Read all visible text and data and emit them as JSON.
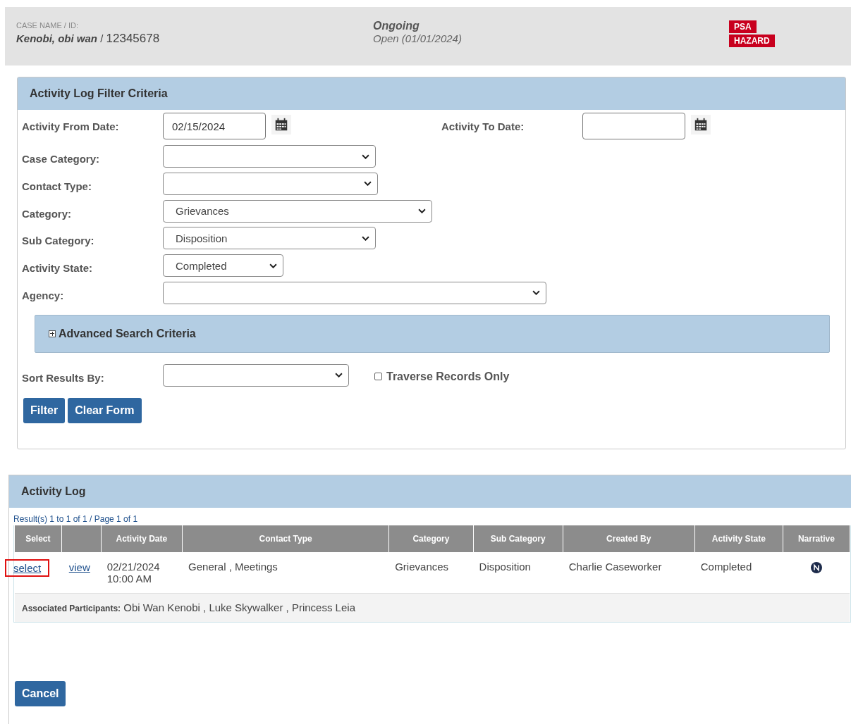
{
  "case_header": {
    "label": "CASE NAME / ID:",
    "name": "Kenobi, obi wan",
    "separator": "/",
    "id": "12345678",
    "status": "Ongoing",
    "open": "Open (01/01/2024)",
    "badges": [
      "PSA",
      "HAZARD"
    ]
  },
  "filter_panel": {
    "title": "Activity Log Filter Criteria",
    "from_date": {
      "label": "Activity From Date:",
      "value": "02/15/2024"
    },
    "to_date": {
      "label": "Activity To Date:"
    },
    "selects": [
      {
        "label": "Case Category:"
      },
      {
        "label": "Contact Type:"
      },
      {
        "label": "Category:",
        "value": "Grievances"
      },
      {
        "label": "Sub Category:",
        "value": "Disposition"
      },
      {
        "label": "Activity State:",
        "value": "Completed"
      },
      {
        "label": "Agency:"
      }
    ],
    "advanced": {
      "label": "Advanced Search Criteria",
      "expanded": false
    },
    "sort": {
      "label": "Sort Results By:"
    },
    "traverse": {
      "label": "Traverse Records Only",
      "checked": false
    },
    "buttons": [
      "Filter",
      "Clear Form"
    ]
  },
  "activity_log": {
    "title": "Activity Log",
    "results": "Result(s) 1 to 1 of 1 / Page 1 of 1",
    "columns": [
      "Select",
      "",
      "Activity Date",
      "Contact Type",
      "Category",
      "Sub Category",
      "Created By",
      "Activity State",
      "Narrative"
    ],
    "rows": [
      {
        "select": "select",
        "select_highlighted": true,
        "view": "view",
        "date": "02/21/2024",
        "time": "10:00 AM",
        "contact_type": "General , Meetings",
        "category": "Grievances",
        "sub_category": "Disposition",
        "created_by": "Charlie Caseworker",
        "state": "Completed",
        "has_narrative": true,
        "participants_label": "Associated Participants:",
        "participants": "Obi Wan Kenobi , Luke Skywalker , Princess Leia"
      }
    ]
  },
  "cancel": "Cancel"
}
